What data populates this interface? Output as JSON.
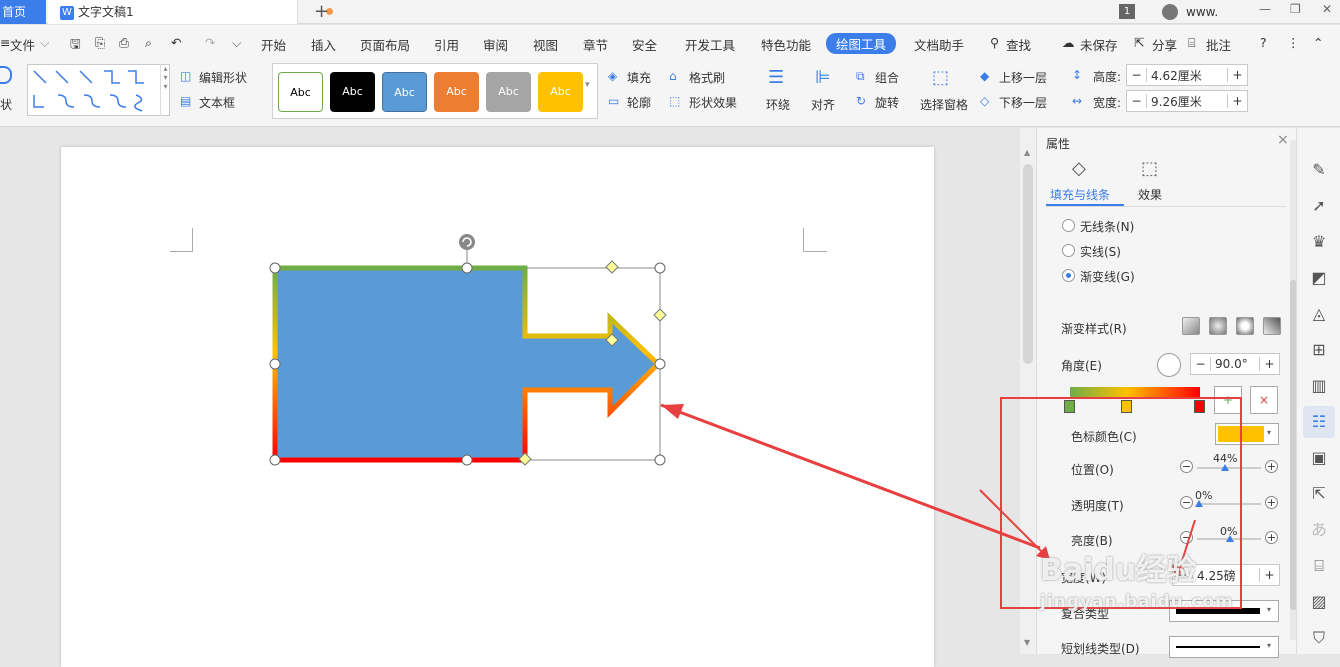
{
  "tabs": {
    "home": "首页",
    "doc": "文字文稿1",
    "badge": "1",
    "account": "www."
  },
  "menu": {
    "file": "文件",
    "items": [
      "开始",
      "插入",
      "页面布局",
      "引用",
      "审阅",
      "视图",
      "章节",
      "安全",
      "开发工具",
      "特色功能",
      "绘图工具",
      "文档助手"
    ],
    "search": "查找",
    "unsaved": "未保存",
    "share": "分享",
    "comment": "批注",
    "help": "?"
  },
  "ribbon": {
    "edit_shape": "编辑形状",
    "textbox": "文本框",
    "shape_label": "状",
    "styles": [
      "Abc",
      "Abc",
      "Abc",
      "Abc",
      "Abc",
      "Abc"
    ],
    "fill": "填充",
    "format_brush": "格式刷",
    "outline": "轮廓",
    "shape_effect": "形状效果",
    "wrap": "环绕",
    "align": "对齐",
    "group": "组合",
    "rotate": "旋转",
    "select_pane": "选择窗格",
    "bring_forward": "上移一层",
    "send_backward": "下移一层",
    "height_label": "高度:",
    "height_value": "4.62厘米",
    "width_label": "宽度:",
    "width_value": "9.26厘米"
  },
  "panel": {
    "title": "属性",
    "tab_fill": "填充与线条",
    "tab_effect": "效果",
    "no_line": "无线条(N)",
    "solid": "实线(S)",
    "gradient": "渐变线(G)",
    "gradient_style": "渐变样式(R)",
    "angle_label": "角度(E)",
    "angle_value": "90.0°",
    "stop_color": "色标颜色(C)",
    "position": "位置(O)",
    "position_value": "44%",
    "transparency": "透明度(T)",
    "transparency_value": "0%",
    "brightness": "亮度(B)",
    "brightness_value": "0%",
    "width": "宽度(W)",
    "width_value": "4.25磅",
    "compound": "复合类型",
    "dash": "短划线类型(D)"
  },
  "colors": {
    "accent": "#3b7de9",
    "shape_fill": "#5b9bd5",
    "gradient_green": "#70ad47",
    "gradient_yellow": "#ffc000",
    "gradient_red": "#ff0000",
    "annotation": "#e84040"
  },
  "watermark": {
    "brand": "Baidu经验",
    "url": "jingyan.baidu.com"
  }
}
